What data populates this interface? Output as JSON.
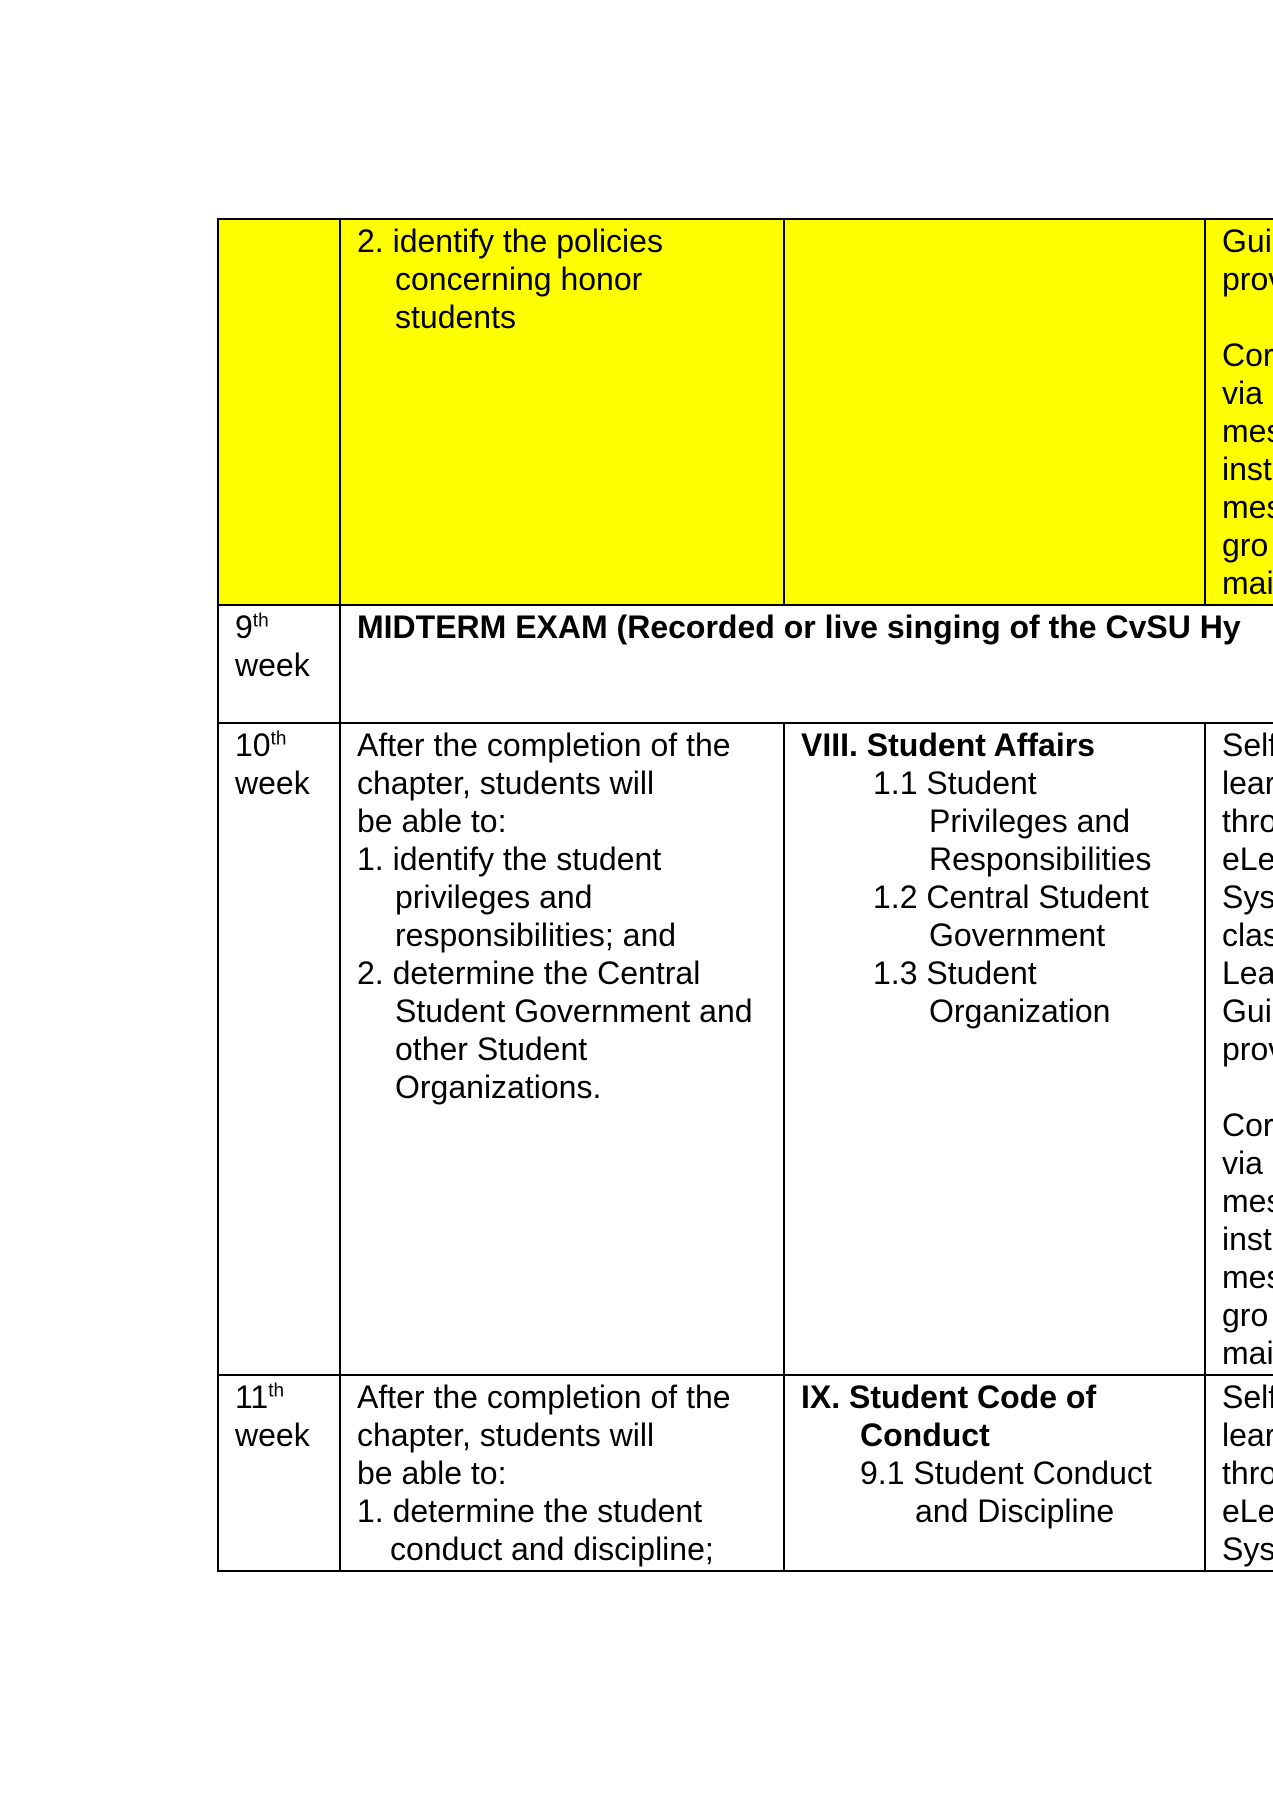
{
  "rows": [
    {
      "week": {
        "num": "",
        "sup": "",
        "word": ""
      },
      "objectives": [
        {
          "text": "2. identify the policies",
          "indent": ""
        },
        {
          "text": "concerning honor",
          "indent": "ind1"
        },
        {
          "text": "students",
          "indent": "ind1"
        }
      ],
      "topics": [],
      "activities": [
        "Gui",
        "prov",
        "",
        "Cor",
        "via",
        "mes",
        "inst",
        "mes",
        "gro",
        "mai"
      ],
      "highlighted": true
    },
    {
      "week": {
        "num": "9",
        "sup": "th",
        "word": "week"
      },
      "midterm": "MIDTERM EXAM (Recorded or live singing of the CvSU Hy"
    },
    {
      "week": {
        "num": "10",
        "sup": "th",
        "word": "week"
      },
      "objectives": [
        {
          "text": "After the completion of the",
          "indent": ""
        },
        {
          "text": "chapter, students will",
          "indent": ""
        },
        {
          "text": "be able to:",
          "indent": ""
        },
        {
          "text": "1. identify the student",
          "indent": ""
        },
        {
          "text": "privileges and",
          "indent": "ind1"
        },
        {
          "text": "responsibilities; and",
          "indent": "ind1"
        },
        {
          "text": "2. determine the Central",
          "indent": ""
        },
        {
          "text": "Student Government and",
          "indent": "ind1"
        },
        {
          "text": "other Student",
          "indent": "ind1"
        },
        {
          "text": "Organizations.",
          "indent": "ind1"
        }
      ],
      "topics": [
        {
          "text": "VIII. Student Affairs",
          "indent": "",
          "bold": true
        },
        {
          "text": "1.1 Student",
          "indent": "ind2",
          "bold": false
        },
        {
          "text": "Privileges and",
          "indent": "ind3",
          "bold": false
        },
        {
          "text": "Responsibilities",
          "indent": "ind3",
          "bold": false
        },
        {
          "text": "1.2 Central Student",
          "indent": "ind2",
          "bold": false
        },
        {
          "text": "Government",
          "indent": "ind3",
          "bold": false
        },
        {
          "text": "1.3 Student",
          "indent": "ind2",
          "bold": false
        },
        {
          "text": "Organization",
          "indent": "ind3",
          "bold": false
        }
      ],
      "activities": [
        "Self",
        "lear",
        "thro",
        "eLe",
        "Sys",
        "clas",
        "Lea",
        "Gui",
        "prov",
        "",
        "Cor",
        "via",
        "mes",
        "inst",
        "mes",
        "gro",
        "mai"
      ]
    },
    {
      "week": {
        "num": "11",
        "sup": "th",
        "word": "week"
      },
      "objectives": [
        {
          "text": "After the completion of the",
          "indent": ""
        },
        {
          "text": "chapter, students will",
          "indent": ""
        },
        {
          "text": "be able to:",
          "indent": ""
        },
        {
          "text": "1. determine the student",
          "indent": ""
        },
        {
          "text": "conduct and discipline;",
          "indent": "ind6"
        }
      ],
      "topics": [
        {
          "text": "IX. Student Code of",
          "indent": "",
          "bold": true
        },
        {
          "text": "Conduct",
          "indent": "ind4",
          "bold": true
        },
        {
          "text": "9.1 Student Conduct",
          "indent": "ind4",
          "bold": false
        },
        {
          "text": "and Discipline",
          "indent": "ind5",
          "bold": false
        }
      ],
      "activities": [
        "Self",
        "lear",
        "thro",
        "eLe",
        "Sys"
      ]
    }
  ]
}
